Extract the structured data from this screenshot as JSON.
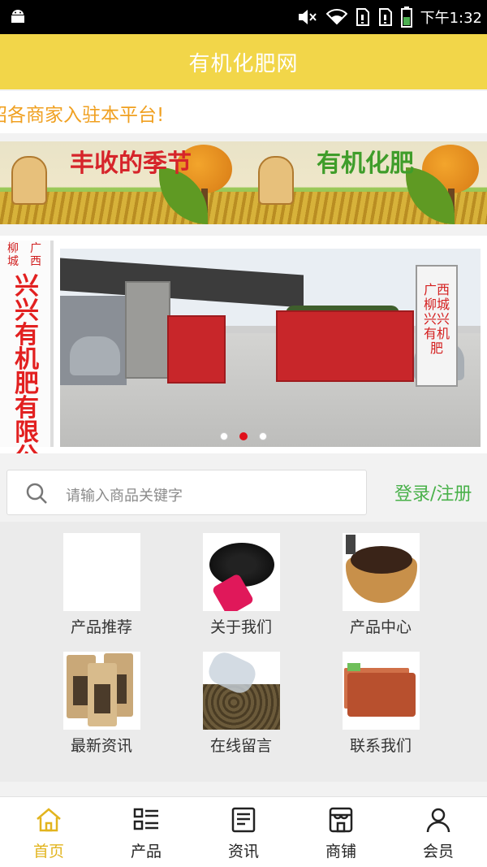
{
  "status_bar": {
    "time": "下午1:32",
    "icons": [
      "android-icon",
      "mute-icon",
      "wifi-icon",
      "sim1-icon",
      "sim2-icon",
      "battery-icon"
    ]
  },
  "header": {
    "title": "有机化肥网"
  },
  "marquee": {
    "text": "招各商家入驻本平台!"
  },
  "banner": {
    "panels": [
      {
        "title": "丰收的季节",
        "color": "#d6242a"
      },
      {
        "title": "有机化肥",
        "color": "#3f9d2a"
      }
    ]
  },
  "carousel": {
    "sign_top_left": "柳城",
    "sign_top_right": "广西",
    "sign_main": "兴兴有机肥有限公司",
    "pillar_sign": "广西柳城兴兴有机肥",
    "dot_count": 3,
    "active_dot": 1
  },
  "search": {
    "placeholder": "请输入商品关键字",
    "login_label": "登录/注册"
  },
  "grid": {
    "items": [
      {
        "label": "产品推荐"
      },
      {
        "label": "关于我们"
      },
      {
        "label": "产品中心"
      },
      {
        "label": "最新资讯"
      },
      {
        "label": "在线留言"
      },
      {
        "label": "联系我们"
      }
    ]
  },
  "bottom_nav": {
    "items": [
      {
        "label": "首页",
        "icon": "home-icon",
        "active": true
      },
      {
        "label": "产品",
        "icon": "list-icon",
        "active": false
      },
      {
        "label": "资讯",
        "icon": "news-icon",
        "active": false
      },
      {
        "label": "商铺",
        "icon": "shop-icon",
        "active": false
      },
      {
        "label": "会员",
        "icon": "user-icon",
        "active": false
      }
    ]
  },
  "colors": {
    "header_bg": "#f2d649",
    "marquee_text": "#f0a020",
    "login_text": "#49b14a",
    "nav_active": "#e2b41e",
    "dot_active": "#e0101a"
  }
}
